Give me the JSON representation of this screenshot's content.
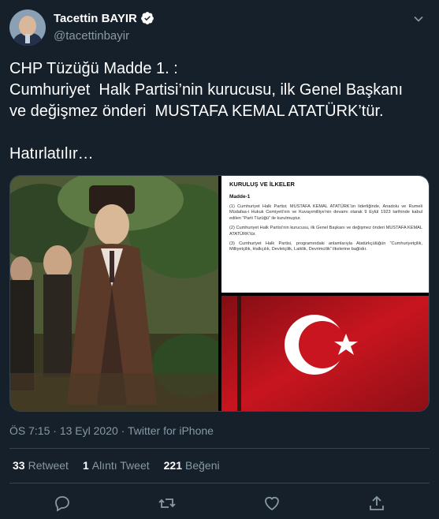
{
  "user": {
    "display_name": "Tacettin BAYIR",
    "handle": "@tacettinbayir"
  },
  "tweet": {
    "text": "CHP Tüzüğü Madde 1. :\nCumhuriyet  Halk Partisi’nin kurucusu, ilk Genel Başkanı\nve değişmez önderi  MUSTAFA KEMAL ATATÜRK’tür.\n\nHatırlatılır…"
  },
  "document": {
    "title": "KURULUŞ VE İLKELER",
    "madde": "Madde-1",
    "p1": "(1) Cumhuriyet Halk Partisi; MUSTAFA KEMAL ATATÜRK’ün liderliğinde, Anadolu ve Rumeli Müdafaa-i Hukuk Cemiyeti’nin ve Kuvayımilliye’nin devamı olarak 9 Eylül 1923 tarihinde kabul edilen “Parti Tüzüğü” ile kurulmuştur.",
    "p2": "(2) Cumhuriyet Halk Partisi’nin kurucusu, ilk Genel Başkanı ve değişmez önderi MUSTAFA KEMAL ATATÜRK’tür.",
    "p3": "(3) Cumhuriyet Halk Partisi, programındaki anlamlarıyla Atatürkçülüğün “Cumhuriyetçilik, Milliyetçilik, Halkçılık, Devletçilik, Laiklik, Devrimcilik” ilkelerine bağlıdır."
  },
  "meta": {
    "time": "ÖS 7:15",
    "date": "13 Eyl 2020",
    "separator": "·",
    "source": "Twitter for iPhone"
  },
  "stats": {
    "retweets_count": "33",
    "retweets_label": "Retweet",
    "quotes_count": "1",
    "quotes_label": "Alıntı Tweet",
    "likes_count": "221",
    "likes_label": "Beğeni"
  },
  "colors": {
    "background": "#15202b",
    "secondary_text": "#8899a6",
    "divider": "#38444d",
    "verified": "#ffffff"
  },
  "icons": {
    "verified": "verified-badge-icon",
    "more": "chevron-down-icon",
    "reply": "reply-icon",
    "retweet": "retweet-icon",
    "like": "heart-icon",
    "share": "share-icon"
  }
}
